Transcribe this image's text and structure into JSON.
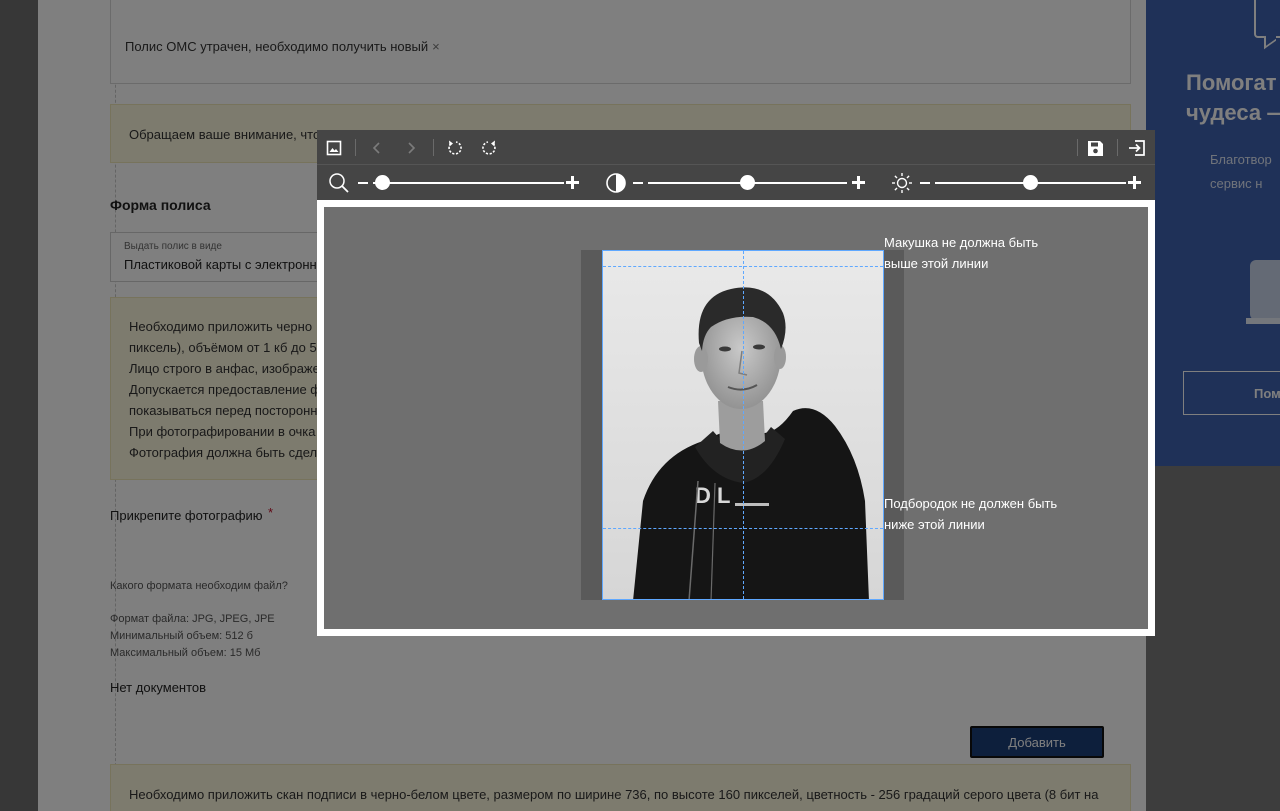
{
  "page": {
    "lost_policy_tag": "Полис ОМС утрачен, необходимо получить новый",
    "tag_remove_glyph": "×",
    "notice_1": "Обращаем ваше внимание, что",
    "section_title": "Форма полиса",
    "policy_form": {
      "label": "Выдать полис в виде",
      "value": "Пластиковой карты с электронн"
    },
    "photo_requirements": [
      "Необходимо приложить черно",
      "пиксель), объёмом от 1 кб до 5",
      "Лицо строго в анфас, изображе",
      "Допускается предоставление ф",
      "показываться перед посторонн",
      "При фотографировании в очка",
      "Фотография должна быть сдел"
    ],
    "attach_label": "Прикрепите фотографию",
    "required_mark": "*",
    "format_question": "Какого формата необходим файл?",
    "format_lines": [
      "Формат файла: JPG, JPEG, JPE",
      "Минимальный объем: 512 б",
      "Максимальный объем: 15 Мб"
    ],
    "no_documents": "Нет документов",
    "add_button": "Добавить",
    "notice_3": "Необходимо приложить скан подписи в черно-белом цвете, размером по ширине 736, по высоте 160 пикселей, цветность - 256 градаций серого цвета (8 бит на"
  },
  "sidebar": {
    "title_line_1": "Помогат",
    "title_line_2": "чудеса —",
    "subtitle_line_1": "Благотвор",
    "subtitle_line_2": "сервис н",
    "button": "Пом"
  },
  "editor": {
    "toolbar": {
      "left": [
        "image-icon",
        "prev-icon",
        "next-icon",
        "rotate-left-icon",
        "rotate-right-icon"
      ],
      "right": [
        "save-icon",
        "exit-icon"
      ]
    },
    "sliders": [
      {
        "name": "zoom",
        "icon": "magnifier-icon",
        "value": 0.05
      },
      {
        "name": "contrast",
        "icon": "contrast-icon",
        "value": 0.5
      },
      {
        "name": "brightness",
        "icon": "sun-icon",
        "value": 0.5
      }
    ],
    "hint_top_1": "Макушка не должна быть",
    "hint_top_2": "выше этой линии",
    "hint_bottom_1": "Подбородок не должен быть",
    "hint_bottom_2": "ниже этой линии",
    "guide_color": "#5fa8ff"
  }
}
